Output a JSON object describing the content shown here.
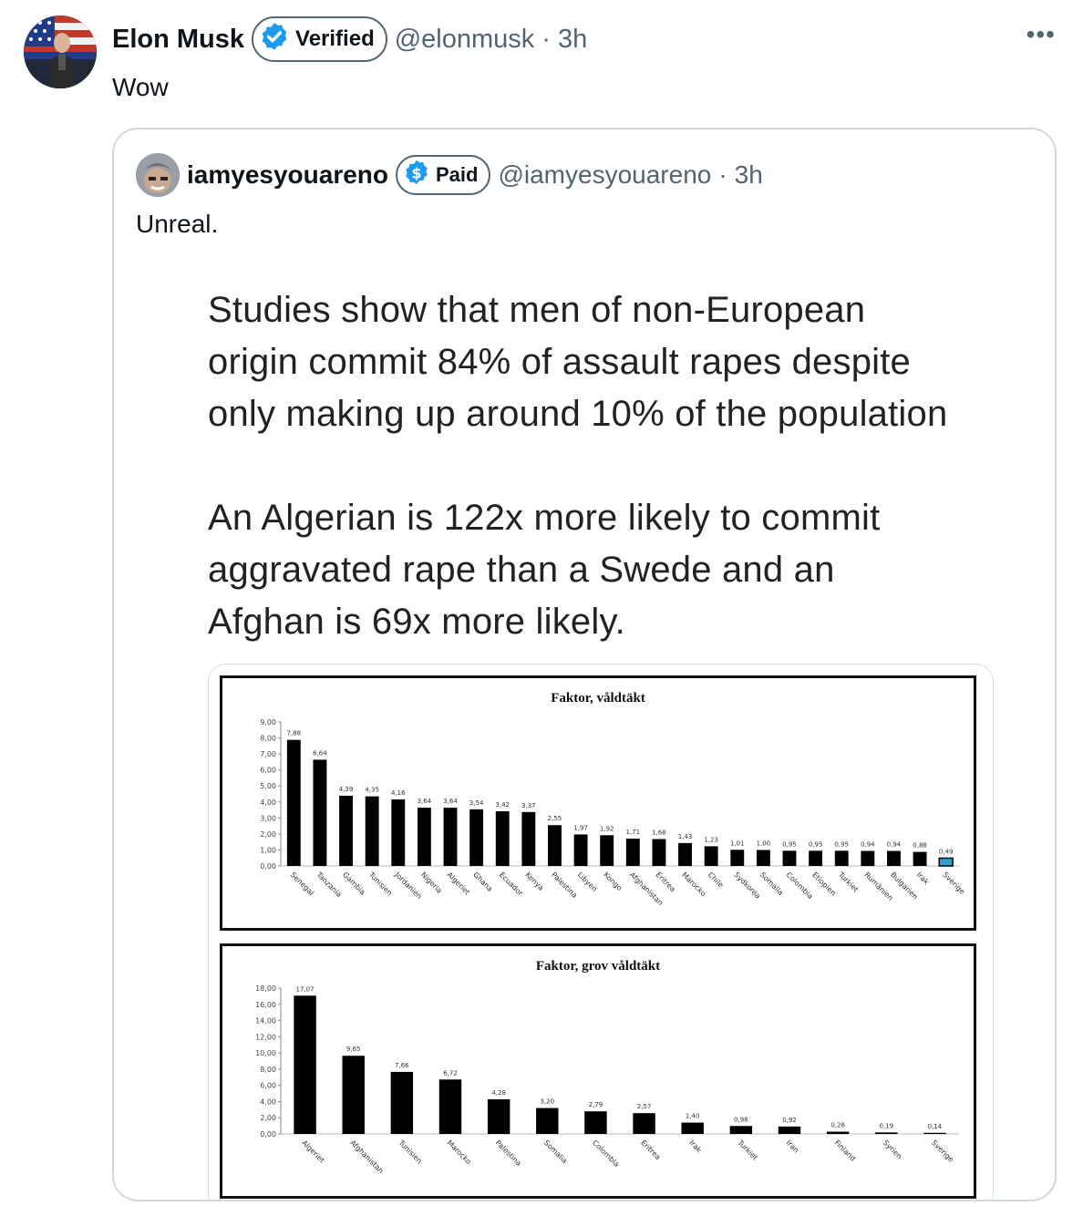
{
  "tweet": {
    "author_name": "Elon Musk",
    "badge_label": "Verified",
    "handle": "@elonmusk",
    "time": "3h",
    "separator": "·",
    "text": "Wow",
    "more_icon": "more-horizontal-icon",
    "badge_color": "#1d9bf0"
  },
  "quote": {
    "author_name": "iamyesyouareno",
    "badge_label": "Paid",
    "handle": "@iamyesyouareno",
    "time": "3h",
    "separator": "·",
    "text": "Unreal.",
    "image_text": {
      "para1_lines": [
        "Studies show that men of non-European",
        "origin commit 84% of assault rapes despite",
        "only making up around 10% of the population"
      ],
      "para2_lines": [
        "An Algerian is 122x more likely to commit",
        "aggravated rape than a Swede and an",
        "Afghan is 69x more likely."
      ]
    }
  },
  "chart_data": [
    {
      "type": "bar",
      "title": "Faktor, våldtäkt",
      "categories": [
        "Senegal",
        "Tanzania",
        "Gambia",
        "Tunisien",
        "Jordanien",
        "Nigeria",
        "Algeriet",
        "Ghana",
        "Ecuador",
        "Kenya",
        "Palestina",
        "Libyen",
        "Kongo",
        "Afghanistan",
        "Eritrea",
        "Marocko",
        "Chile",
        "Sydkorea",
        "Somalia",
        "Colombia",
        "Etiopien",
        "Turkiet",
        "Rumänien",
        "Bulgarien",
        "Irak",
        "Sverige"
      ],
      "values": [
        7.88,
        6.64,
        4.39,
        4.35,
        4.16,
        3.64,
        3.64,
        3.54,
        3.42,
        3.37,
        2.55,
        1.97,
        1.92,
        1.71,
        1.68,
        1.43,
        1.23,
        1.01,
        1.0,
        0.95,
        0.95,
        0.95,
        0.94,
        0.94,
        0.88,
        0.49
      ],
      "value_labels": [
        "7,88",
        "6,64",
        "4,39",
        "4,35",
        "4,16",
        "3,64",
        "3,64",
        "3,54",
        "3,42",
        "3,37",
        "2,55",
        "1,97",
        "1,92",
        "1,71",
        "1,68",
        "1,43",
        "1,23",
        "1,01",
        "1,00",
        "0,95",
        "0,95",
        "0,95",
        "0,94",
        "0,94",
        "0,88",
        "0,49"
      ],
      "yticks": [
        "0,00",
        "1,00",
        "2,00",
        "3,00",
        "4,00",
        "5,00",
        "6,00",
        "7,00",
        "8,00",
        "9,00"
      ],
      "ylim": [
        0,
        9
      ],
      "bar_color": "#000000",
      "highlight_index": 25,
      "highlight_color": "#2a9fd0"
    },
    {
      "type": "bar",
      "title": "Faktor, grov våldtäkt",
      "categories": [
        "Algeriet",
        "Afghanistan",
        "Tunisien",
        "Marocko",
        "Palestina",
        "Somalia",
        "Colombia",
        "Eritrea",
        "Irak",
        "Turkiet",
        "Iran",
        "Finland",
        "Syrien",
        "Sverige"
      ],
      "values": [
        17.07,
        9.65,
        7.66,
        6.72,
        4.28,
        3.2,
        2.79,
        2.57,
        1.4,
        0.98,
        0.92,
        0.28,
        0.19,
        0.14
      ],
      "value_labels": [
        "17,07",
        "9,65",
        "7,66",
        "6,72",
        "4,28",
        "3,20",
        "2,79",
        "2,57",
        "1,40",
        "0,98",
        "0,92",
        "0,28",
        "0,19",
        "0,14"
      ],
      "yticks": [
        "0,00",
        "2,00",
        "4,00",
        "6,00",
        "8,00",
        "10,00",
        "12,00",
        "14,00",
        "16,00",
        "18,00"
      ],
      "ylim": [
        0,
        18
      ],
      "bar_color": "#000000"
    }
  ]
}
